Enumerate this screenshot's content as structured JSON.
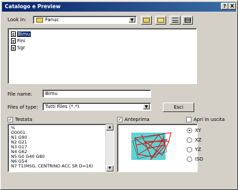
{
  "window": {
    "title": "Catalogo e Preview",
    "help_btn": "?",
    "close_btn": "X"
  },
  "lookin": {
    "label": "Look in:",
    "value": "Fanuc"
  },
  "files": [
    {
      "name": "Bimu",
      "selected": true
    },
    {
      "name": "Fini",
      "selected": false
    },
    {
      "name": "Sgr",
      "selected": false
    }
  ],
  "filename": {
    "label": "File name:",
    "value": "Bimu"
  },
  "filetype": {
    "label": "Files of type:",
    "value": "Tutti Files (*.*)"
  },
  "exit_button": "Esci",
  "testata": {
    "label": "Testata",
    "checked": true
  },
  "code_lines": [
    "%",
    "O0001",
    "N1 G90",
    "N2 G21",
    "N3 G17",
    "N4 G62",
    "N5 G0 G40 G80",
    "N6 G54",
    "N7 T1(MSG, CENTRINO ACC SR D=16)"
  ],
  "anteprima": {
    "label": "Anteprima",
    "checked": true
  },
  "apri": {
    "label": "Apri in uscita",
    "checked": false
  },
  "views": [
    {
      "label": "XY",
      "selected": true
    },
    {
      "label": "XZ",
      "selected": false
    },
    {
      "label": "YZ",
      "selected": false
    },
    {
      "label": "ISO",
      "selected": false
    }
  ],
  "colors": {
    "accent": "#0a246a",
    "preview_bg": "#5fd3d3",
    "path": "#e00000"
  }
}
